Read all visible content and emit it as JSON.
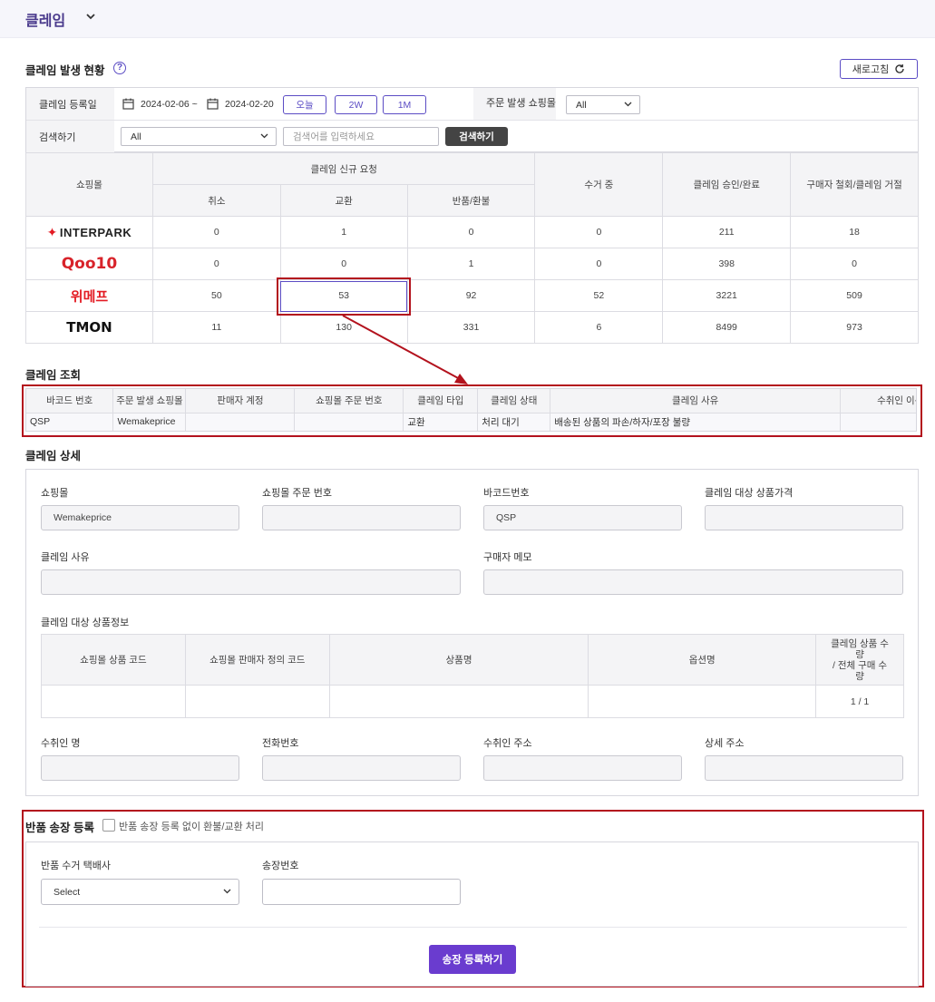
{
  "header": {
    "title": "클레임"
  },
  "status_section": {
    "title": "클레임 발생 현황",
    "help": "?",
    "refresh_label": "새로고침"
  },
  "filters": {
    "date_label": "클레임 등록일",
    "date_from": "2024-02-06 ~",
    "date_to": "2024-02-20",
    "btn_today": "오늘",
    "btn_2w": "2W",
    "btn_1m": "1M",
    "mall_label": "주문 발생 쇼핑몰",
    "mall_value": "All",
    "search_label": "검색하기",
    "search_type": "All",
    "search_placeholder": "검색어를 입력하세요",
    "search_button": "검색하기"
  },
  "stats_table": {
    "col_mall": "쇼핑몰",
    "col_new_request": "클레임 신규 요청",
    "col_cancel": "취소",
    "col_exchange": "교환",
    "col_return": "반품/환불",
    "col_collecting": "수거 중",
    "col_approved": "클레임 승인/완료",
    "col_rejected": "구매자 철회/클레임 거절",
    "rows": [
      {
        "mall": "INTERPARK",
        "cancel": "0",
        "exchange": "1",
        "return": "0",
        "collecting": "0",
        "approved": "211",
        "rejected": "18"
      },
      {
        "mall": "Qoo10",
        "cancel": "0",
        "exchange": "0",
        "return": "1",
        "collecting": "0",
        "approved": "398",
        "rejected": "0"
      },
      {
        "mall": "위메프",
        "cancel": "50",
        "exchange": "53",
        "return": "92",
        "collecting": "52",
        "approved": "3221",
        "rejected": "509"
      },
      {
        "mall": "TMON",
        "cancel": "11",
        "exchange": "130",
        "return": "331",
        "collecting": "6",
        "approved": "8499",
        "rejected": "973"
      }
    ]
  },
  "claim_list": {
    "title": "클레임 조회",
    "headers": [
      "바코드 번호",
      "주문 발생 쇼핑몰",
      "판매자 계정",
      "쇼핑몰 주문 번호",
      "클레임 타입",
      "클레임 상태",
      "클레임 사유",
      "수취인 이름"
    ],
    "row": {
      "barcode": "QSP",
      "mall": "Wemakeprice",
      "seller": "",
      "order_no": "",
      "type": "교환",
      "status": "처리 대기",
      "reason": "배송된 상품의 파손/하자/포장 불량",
      "receiver": ""
    }
  },
  "detail": {
    "title": "클레임 상세",
    "mall_label": "쇼핑몰",
    "mall_value": "Wemakeprice",
    "order_no_label": "쇼핑몰 주문 번호",
    "order_no_value": "",
    "barcode_label": "바코드번호",
    "barcode_value": "QSP",
    "price_label": "클레임 대상 상품가격",
    "price_value": "",
    "reason_label": "클레임 사유",
    "reason_value": "",
    "memo_label": "구매자 메모",
    "memo_value": "",
    "product_info_label": "클레임 대상 상품정보",
    "product_headers": {
      "code": "쇼핑몰 상품 코드",
      "seller_code": "쇼핑몰 판매자 정의 코드",
      "name": "상품명",
      "option": "옵션명",
      "qty_line1": "클레임 상품 수",
      "qty_line2": "량",
      "qty_line3": "/ 전체 구매 수",
      "qty_line4": "량"
    },
    "product_row": {
      "code": "",
      "seller_code": "",
      "name": "",
      "option": "",
      "qty": "1 / 1"
    },
    "receiver_label": "수취인 명",
    "receiver_value": "",
    "phone_label": "전화번호",
    "phone_value": "",
    "address_label": "수취인 주소",
    "address_value": "",
    "address_detail_label": "상세 주소",
    "address_detail_value": ""
  },
  "return_shipping": {
    "title": "반품 송장 등록",
    "checkbox_label": "반품 송장 등록 없이 환불/교환 처리",
    "courier_label": "반품 수거 택배사",
    "courier_value": "Select",
    "invoice_label": "송장번호",
    "invoice_value": "",
    "submit_label": "송장 등록하기"
  },
  "colors": {
    "accent": "#5b4cc4",
    "primary_button": "#6a3ccf",
    "highlight_border": "#b3121d",
    "header_bg": "#f6f6fb"
  }
}
